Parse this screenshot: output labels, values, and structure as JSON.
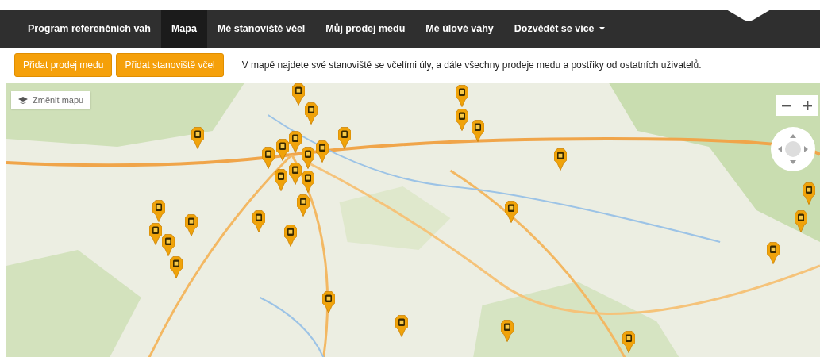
{
  "navbar": {
    "items": [
      {
        "label": "Program referenčních vah",
        "selected": false,
        "dropdown": false
      },
      {
        "label": "Mapa",
        "selected": true,
        "dropdown": false
      },
      {
        "label": "Mé stanoviště včel",
        "selected": false,
        "dropdown": false
      },
      {
        "label": "Můj prodej medu",
        "selected": false,
        "dropdown": false
      },
      {
        "label": "Mé úlové váhy",
        "selected": false,
        "dropdown": false
      },
      {
        "label": "Dozvědět se více",
        "selected": false,
        "dropdown": true
      }
    ]
  },
  "toolbar": {
    "buttons": [
      "Přidat prodej medu",
      "Přidat stanoviště včel"
    ],
    "info": "V mapě najdete své stanoviště se včelími úly, a dále všechny prodeje medu a postřiky od ostatních uživatelů."
  },
  "map": {
    "kind": "picture",
    "layer_button": "Změnit mapu"
  }
}
